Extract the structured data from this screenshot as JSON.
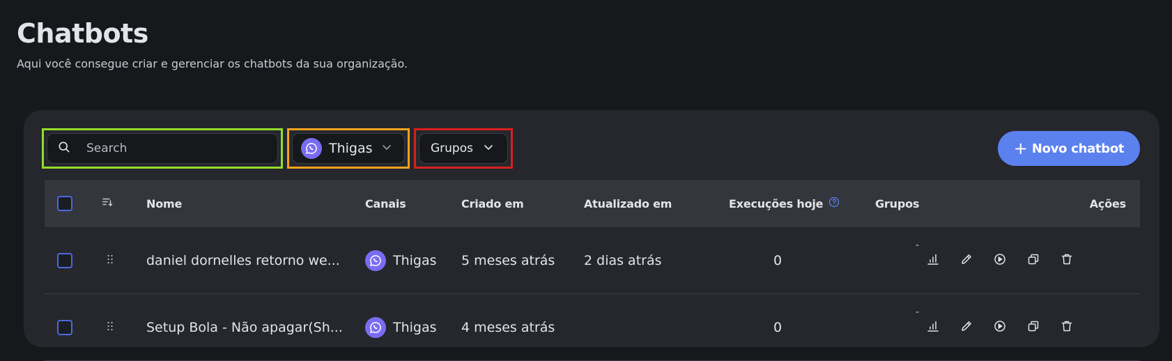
{
  "header": {
    "title": "Chatbots",
    "subtitle": "Aqui você consegue criar e gerenciar os chatbots da sua organização."
  },
  "toolbar": {
    "search_placeholder": "Search",
    "channel_label": "Thigas",
    "groups_label": "Grupos",
    "new_button_plus": "+",
    "new_button_label": "Novo chatbot"
  },
  "table": {
    "columns": {
      "name": "Nome",
      "channels": "Canais",
      "created": "Criado em",
      "updated": "Atualizado em",
      "executions": "Execuções hoje",
      "groups": "Grupos",
      "actions": "Ações"
    },
    "rows": [
      {
        "name": "daniel dornelles retorno we...",
        "channel": "Thigas",
        "created": "5 meses atrás",
        "updated": "2 dias atrás",
        "executions": "0",
        "groups": "-"
      },
      {
        "name": "Setup Bola - Não apagar(Sh...",
        "channel": "Thigas",
        "created": "4 meses atrás",
        "updated": "",
        "executions": "0",
        "groups": "-"
      }
    ]
  },
  "colors": {
    "background": "#17181c",
    "card": "#25272d",
    "accent": "#5b81ef",
    "channel_icon": "#7a6cf2",
    "highlight_search": "#93dd2a",
    "highlight_channel": "#f5a21f",
    "highlight_groups": "#d8201d"
  },
  "icons": {
    "search": "search-icon",
    "channel": "whatsapp-icon",
    "dropdown": "chevron-down-icon",
    "sort": "sort-icon",
    "help": "help-circle-icon",
    "drag": "drag-handle-icon",
    "analytics": "bar-chart-icon",
    "edit": "pencil-icon",
    "run": "play-circle-icon",
    "duplicate": "copy-icon",
    "delete": "trash-icon"
  }
}
